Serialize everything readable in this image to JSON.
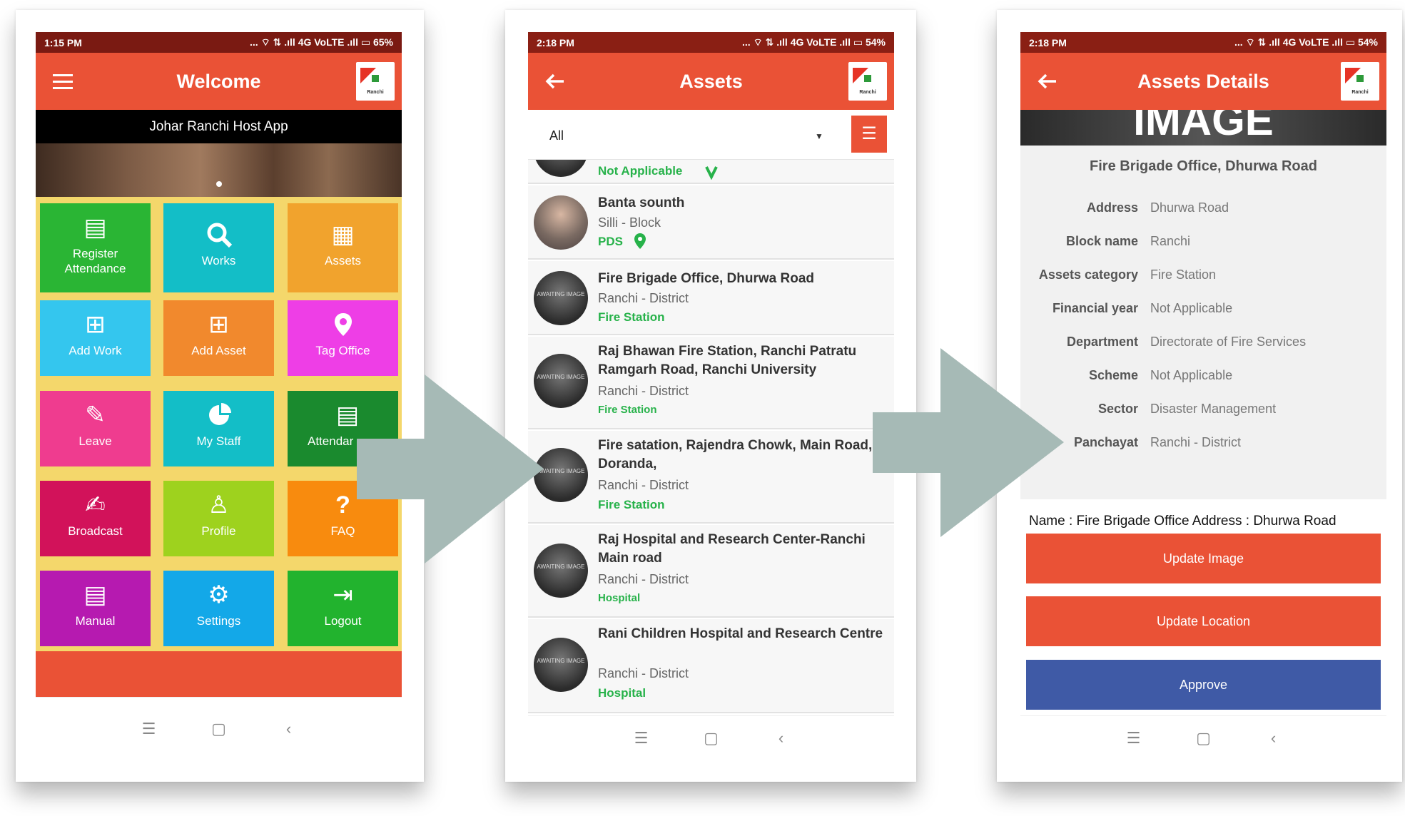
{
  "colors": {
    "accent": "#ea5236",
    "statusbar": "#7a1a12",
    "tile_yellow": "#f4d76b",
    "arrow": "#a6bab6",
    "approve": "#3f5aa6",
    "category_green": "#27b24a"
  },
  "screen1": {
    "status": {
      "time": "1:15 PM",
      "icons": "... ⌔ ⇅ .ıll 4G VoLTE .ıll ▭ 65%"
    },
    "appbar": {
      "title": "Welcome",
      "logo_text": "Ranchi"
    },
    "banner": {
      "title": "Johar Ranchi Host App"
    },
    "tiles": [
      {
        "label": "Register Attendance",
        "icon": "book-icon"
      },
      {
        "label": "Works",
        "icon": "search-icon"
      },
      {
        "label": "Assets",
        "icon": "building-icon"
      },
      {
        "label": "Add Work",
        "icon": "plus-square-icon"
      },
      {
        "label": "Add Asset",
        "icon": "plus-square-icon"
      },
      {
        "label": "Tag Office",
        "icon": "map-pin-icon"
      },
      {
        "label": "Leave",
        "icon": "pencil-icon"
      },
      {
        "label": "My Staff",
        "icon": "pie-chart-icon"
      },
      {
        "label": "Attendar",
        "icon": "book-icon"
      },
      {
        "label": "Broadcast",
        "icon": "edit-icon"
      },
      {
        "label": "Profile",
        "icon": "person-icon"
      },
      {
        "label": "FAQ",
        "icon": "question-icon"
      },
      {
        "label": "Manual",
        "icon": "book-icon"
      },
      {
        "label": "Settings",
        "icon": "gears-icon"
      },
      {
        "label": "Logout",
        "icon": "logout-icon"
      }
    ]
  },
  "screen2": {
    "status": {
      "time": "2:18 PM",
      "icons": "... ⌔ ⇅ .ıll 4G VoLTE .ıll ▭ 54%"
    },
    "appbar": {
      "title": "Assets",
      "logo_text": "Ranchi"
    },
    "filter": {
      "selected": "All"
    },
    "items": [
      {
        "name": "",
        "location": "",
        "category": "Not Applicable"
      },
      {
        "name": "Banta sounth",
        "location": "Silli - Block",
        "category": "PDS"
      },
      {
        "name": "Fire Brigade Office, Dhurwa Road",
        "location": "Ranchi - District",
        "category": "Fire Station"
      },
      {
        "name": "Raj Bhawan Fire Station, Ranchi Patratu Ramgarh Road, Ranchi University",
        "location": "Ranchi - District",
        "category": "Fire Station"
      },
      {
        "name": "Fire satation, Rajendra Chowk, Main Road, Doranda,",
        "location": "Ranchi - District",
        "category": "Fire Station"
      },
      {
        "name": "Raj Hospital and Research Center-Ranchi Main road",
        "location": "Ranchi - District",
        "category": "Hospital"
      },
      {
        "name": "Rani Children Hospital and Research Centre",
        "location": "Ranchi - District",
        "category": "Hospital"
      }
    ],
    "avatar_text": "AWAITING IMAGE"
  },
  "screen3": {
    "status": {
      "time": "2:18 PM",
      "icons": "... ⌔ ⇅ .ıll 4G VoLTE .ıll ▭ 54%"
    },
    "appbar": {
      "title": "Assets Details",
      "logo_text": "Ranchi"
    },
    "image_text": "IMAGE",
    "title": "Fire Brigade Office, Dhurwa Road",
    "details": [
      {
        "key": "Address",
        "value": "Dhurwa Road"
      },
      {
        "key": "Block name",
        "value": "Ranchi"
      },
      {
        "key": "Assets category",
        "value": "Fire Station"
      },
      {
        "key": "Financial year",
        "value": "Not Applicable"
      },
      {
        "key": "Department",
        "value": "Directorate of Fire Services"
      },
      {
        "key": "Scheme",
        "value": "Not Applicable"
      },
      {
        "key": "Sector",
        "value": "Disaster Management"
      },
      {
        "key": "Panchayat",
        "value": "Ranchi - District"
      }
    ],
    "summary": "Name : Fire Brigade Office Address : Dhurwa Road",
    "buttons": {
      "update_image": "Update Image",
      "update_location": "Update Location",
      "approve": "Approve"
    }
  }
}
